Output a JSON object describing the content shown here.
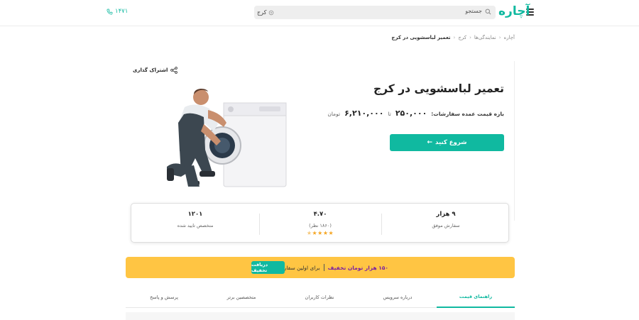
{
  "header": {
    "logo": "آچاره",
    "search_placeholder": "جستجو",
    "city": "کرج",
    "phone": "۱۴۷۱",
    "accent_color": "#10b9a0"
  },
  "breadcrumb": [
    "آچاره",
    "نمایندگی‌ها",
    "کرج",
    "تعمیر لباسشویی در کرج"
  ],
  "hero": {
    "share_label": "اشتراک گذاری",
    "title": "تعمیر لباسشویی در کرج",
    "price_label": "بازه قیمت عمده سفارشات:",
    "price_min": "۲۵۰,۰۰۰",
    "price_to": "تا",
    "price_max": "۶,۲۱۰,۰۰۰",
    "price_unit": "تومان",
    "start_button": "شروع کنید",
    "illustration": "technician-repairing-washing-machine"
  },
  "stats": [
    {
      "value": "۹ هزار",
      "label": "سفارش موفق"
    },
    {
      "value": "۴.۷۰",
      "label": "(۱۸۶۰ نظر)",
      "rating": 4.7
    },
    {
      "value": "۱۲۰۱",
      "label": "متخصص تایید شده"
    }
  ],
  "promo": {
    "highlight": "۱۵۰ هزار تومان تخفیف",
    "text": "برای اولین سفارش،",
    "button": "دریافت تخفیف",
    "background": "#ffc543"
  },
  "tabs": [
    {
      "label": "راهنمای قیمت",
      "active": true
    },
    {
      "label": "درباره سرویس",
      "active": false
    },
    {
      "label": "نظرات کاربران",
      "active": false
    },
    {
      "label": "متخصصین برتر",
      "active": false
    },
    {
      "label": "پرسش و پاسخ",
      "active": false
    }
  ]
}
